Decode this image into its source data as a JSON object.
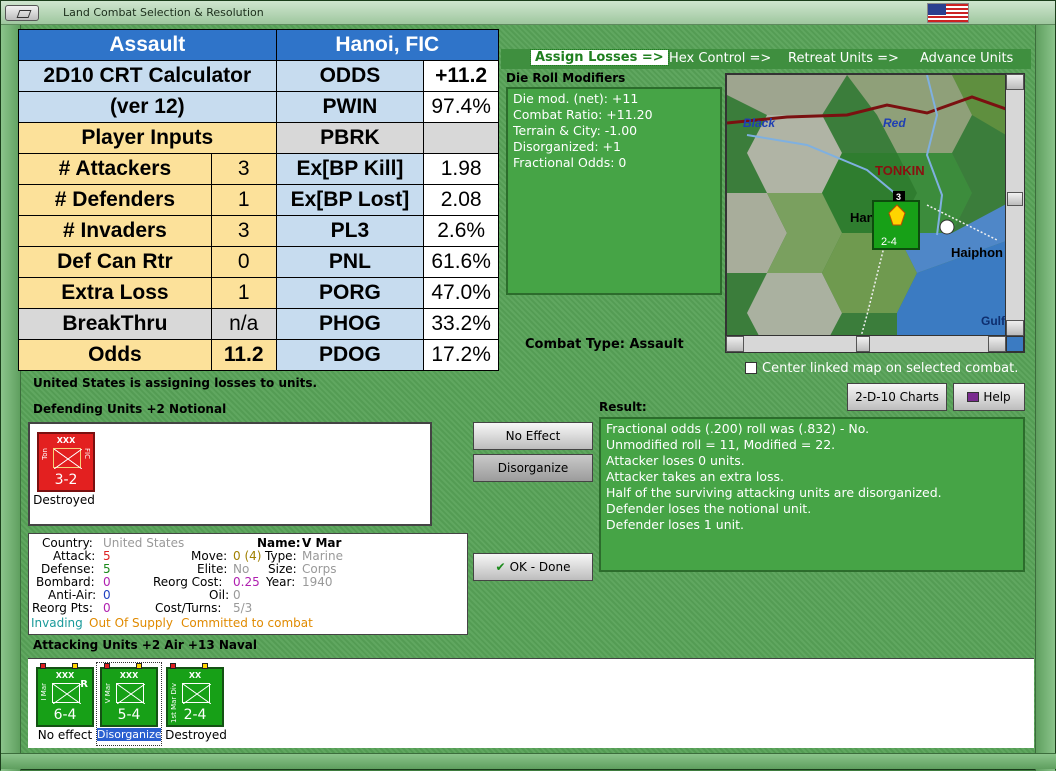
{
  "window": {
    "title": "Land Combat Selection & Resolution"
  },
  "calculator": {
    "combat_type": "Assault",
    "location": "Hanoi, FIC",
    "name_line1": "2D10 CRT Calculator",
    "name_line2": "(ver 12)",
    "player_inputs_label": "Player Inputs",
    "inputs": [
      {
        "label": "# Attackers",
        "value": "3"
      },
      {
        "label": "# Defenders",
        "value": "1"
      },
      {
        "label": "# Invaders",
        "value": "3"
      },
      {
        "label": "Def Can Rtr",
        "value": "0"
      },
      {
        "label": "Extra Loss",
        "value": "1"
      },
      {
        "label": "BreakThru",
        "value": "n/a"
      },
      {
        "label": "Odds",
        "value": "11.2"
      }
    ],
    "outputs": [
      {
        "label": "ODDS",
        "value": "+11.2"
      },
      {
        "label": "PWIN",
        "value": "97.4%"
      },
      {
        "label": "PBRK",
        "value": ""
      },
      {
        "label": "Ex[BP Kill]",
        "value": "1.98"
      },
      {
        "label": "Ex[BP Lost]",
        "value": "2.08"
      },
      {
        "label": "PL3",
        "value": "2.6%"
      },
      {
        "label": "PNL",
        "value": "61.6%"
      },
      {
        "label": "PORG",
        "value": "47.0%"
      },
      {
        "label": "PHOG",
        "value": "33.2%"
      },
      {
        "label": "PDOG",
        "value": "17.2%"
      }
    ]
  },
  "tabs": [
    {
      "label": "Assign Losses =>",
      "active": true
    },
    {
      "label": "Hex Control =>",
      "active": false
    },
    {
      "label": "Retreat Units =>",
      "active": false
    },
    {
      "label": "Advance Units",
      "active": false
    }
  ],
  "die_roll": {
    "title": "Die Roll Modifiers",
    "lines": [
      "Die mod. (net): +11",
      "",
      "Combat Ratio: +11.20",
      "Terrain & City: -1.00",
      "Disorganized: +1",
      "Fractional Odds: 0"
    ]
  },
  "map": {
    "labels": {
      "black": "Black",
      "red": "Red",
      "region": "TONKIN",
      "city1": "Han",
      "city2": "Haiphon",
      "gulf": "Gulf"
    },
    "unit_stack": "3",
    "unit_strength": "2-4"
  },
  "combat_type_label": "Combat Type:  Assault",
  "center_linked_label": "Center linked map on selected combat.",
  "buttons": {
    "crt_charts": "2-D-10 Charts",
    "help": "Help",
    "no_effect": "No Effect",
    "disorganize": "Disorganize",
    "ok_done": "OK - Done"
  },
  "status_message": "United States is assigning losses to units.",
  "defending": {
    "title": "Defending Units +2 Notional",
    "unit": {
      "size": "XXX",
      "side_text": "Ton",
      "side_text2": "FIC",
      "strength": "3-2",
      "caption": "Destroyed"
    }
  },
  "unit_info": {
    "country_label": "Country:",
    "country": "United States",
    "name_label": "Name:",
    "name": "V Mar",
    "attack_label": "Attack:",
    "attack": "5",
    "move_label": "Move:",
    "move": "0 (4)",
    "type_label": "Type:",
    "type": "Marine",
    "defense_label": "Defense:",
    "defense": "5",
    "elite_label": "Elite:",
    "elite": "No",
    "size_label": "Size:",
    "size": "Corps",
    "bombard_label": "Bombard:",
    "bombard": "0",
    "reorg_cost_label": "Reorg Cost:",
    "reorg_cost": "0.25",
    "year_label": "Year:",
    "year": "1940",
    "antiair_label": "Anti-Air:",
    "antiair": "0",
    "oil_label": "Oil:",
    "oil": "0",
    "reorg_pts_label": "Reorg Pts:",
    "reorg_pts": "0",
    "cost_turns_label": "Cost/Turns:",
    "cost_turns": "5/3",
    "status_invading": "Invading",
    "status_supply": "Out Of Supply",
    "status_committed": "Committed to combat"
  },
  "result": {
    "title": "Result:",
    "lines": [
      "Fractional odds (.200) roll was (.832)  - No.",
      "Unmodified roll = 11, Modified = 22.",
      "Attacker loses 0 units.",
      "Attacker takes an extra loss.",
      "Half of the surviving attacking units are disorganized.",
      "Defender loses the notional unit.",
      "Defender loses 1 unit."
    ]
  },
  "attacking": {
    "title": "Attacking Units +2 Air +13 Naval",
    "units": [
      {
        "size": "XXX",
        "side_text": "I Mar",
        "strength": "6-4",
        "caption": "No effect",
        "badge": "R",
        "selected": false
      },
      {
        "size": "XXX",
        "side_text": "V Mar",
        "strength": "5-4",
        "caption": "Disorganized",
        "badge": "",
        "selected": true
      },
      {
        "size": "XX",
        "side_text": "1st Mar Div",
        "strength": "2-4",
        "caption": "Destroyed",
        "badge": "",
        "selected": false
      }
    ]
  },
  "colors": {
    "panel_green": "#46a446",
    "header_blue": "#2f74c9",
    "input_yellow": "#fce19a",
    "output_blue": "#c7dcef"
  }
}
